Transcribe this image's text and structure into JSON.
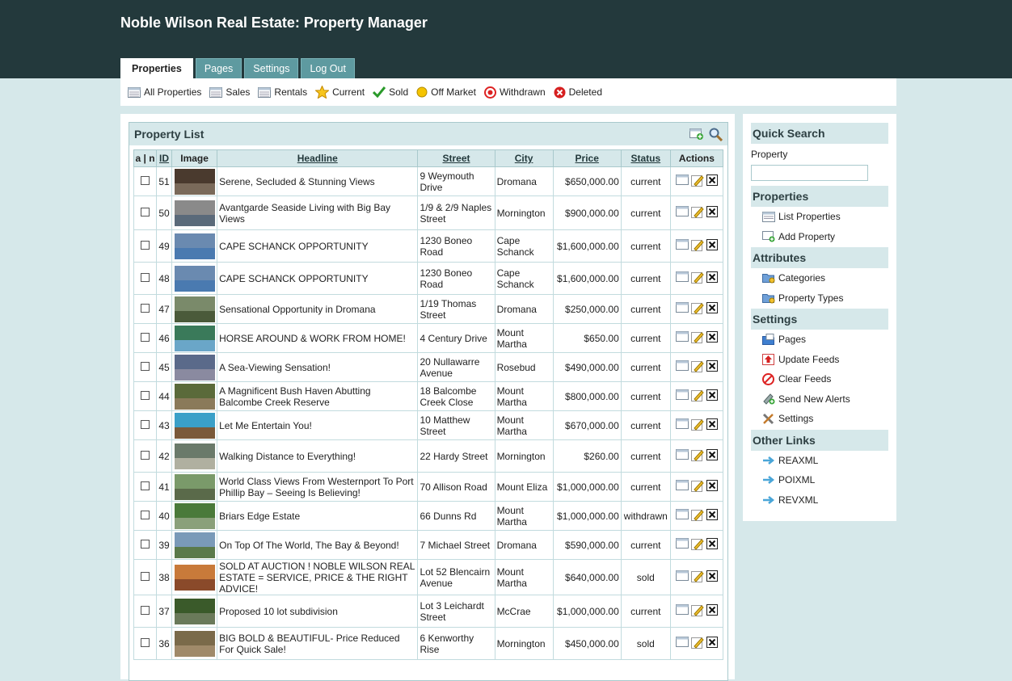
{
  "app": {
    "title": "Noble Wilson Real Estate: Property Manager"
  },
  "tabs": [
    {
      "label": "Properties",
      "active": true
    },
    {
      "label": "Pages"
    },
    {
      "label": "Settings"
    },
    {
      "label": "Log Out"
    }
  ],
  "filters": [
    {
      "label": "All Properties",
      "icon": "list-icon"
    },
    {
      "label": "Sales",
      "icon": "list-icon"
    },
    {
      "label": "Rentals",
      "icon": "list-icon"
    },
    {
      "label": "Current",
      "icon": "star-icon"
    },
    {
      "label": "Sold",
      "icon": "check-icon"
    },
    {
      "label": "Off Market",
      "icon": "yellow-dot-icon"
    },
    {
      "label": "Withdrawn",
      "icon": "withdrawn-icon"
    },
    {
      "label": "Deleted",
      "icon": "deleted-icon"
    }
  ],
  "property_list": {
    "title": "Property List",
    "columns": {
      "select": "a | n",
      "id": "ID",
      "image": "Image",
      "headline": "Headline",
      "street": "Street",
      "city": "City",
      "price": "Price",
      "status": "Status",
      "actions": "Actions"
    },
    "rows": [
      {
        "id": "51",
        "headline": "Serene, Secluded & Stunning Views",
        "street": "9 Weymouth Drive",
        "city": "Dromana",
        "price": "$650,000.00",
        "status": "current"
      },
      {
        "id": "50",
        "headline": "Avantgarde Seaside Living with Big Bay Views",
        "street": "1/9 & 2/9 Naples Street",
        "city": "Mornington",
        "price": "$900,000.00",
        "status": "current"
      },
      {
        "id": "49",
        "headline": "CAPE SCHANCK OPPORTUNITY",
        "street": "1230 Boneo Road",
        "city": "Cape Schanck",
        "price": "$1,600,000.00",
        "status": "current"
      },
      {
        "id": "48",
        "headline": "CAPE SCHANCK OPPORTUNITY",
        "street": "1230 Boneo Road",
        "city": "Cape Schanck",
        "price": "$1,600,000.00",
        "status": "current"
      },
      {
        "id": "47",
        "headline": "Sensational Opportunity in Dromana",
        "street": "1/19 Thomas Street",
        "city": "Dromana",
        "price": "$250,000.00",
        "status": "current"
      },
      {
        "id": "46",
        "headline": "HORSE AROUND & WORK FROM HOME!",
        "street": "4 Century Drive",
        "city": "Mount Martha",
        "price": "$650.00",
        "status": "current"
      },
      {
        "id": "45",
        "headline": "A Sea-Viewing Sensation!",
        "street": "20 Nullawarre Avenue",
        "city": "Rosebud",
        "price": "$490,000.00",
        "status": "current"
      },
      {
        "id": "44",
        "headline": "A Magnificent Bush Haven Abutting Balcombe Creek Reserve",
        "street": "18 Balcombe Creek Close",
        "city": "Mount Martha",
        "price": "$800,000.00",
        "status": "current"
      },
      {
        "id": "43",
        "headline": "Let Me Entertain You!",
        "street": "10 Matthew Street",
        "city": "Mount Martha",
        "price": "$670,000.00",
        "status": "current"
      },
      {
        "id": "42",
        "headline": "Walking Distance to Everything!",
        "street": "22 Hardy Street",
        "city": "Mornington",
        "price": "$260.00",
        "status": "current"
      },
      {
        "id": "41",
        "headline": "World Class Views From Westernport To Port Phillip Bay – Seeing Is Believing!",
        "street": "70 Allison Road",
        "city": "Mount Eliza",
        "price": "$1,000,000.00",
        "status": "current"
      },
      {
        "id": "40",
        "headline": "Briars Edge Estate",
        "street": "66 Dunns Rd",
        "city": "Mount Martha",
        "price": "$1,000,000.00",
        "status": "withdrawn"
      },
      {
        "id": "39",
        "headline": "On Top Of The World, The Bay & Beyond!",
        "street": "7 Michael Street",
        "city": "Dromana",
        "price": "$590,000.00",
        "status": "current"
      },
      {
        "id": "38",
        "headline": "SOLD AT AUCTION ! NOBLE WILSON REAL ESTATE = SERVICE, PRICE & THE RIGHT ADVICE!",
        "street": "Lot 52 Blencairn Avenue",
        "city": "Mount Martha",
        "price": "$640,000.00",
        "status": "sold"
      },
      {
        "id": "37",
        "headline": "Proposed 10 lot subdivision",
        "street": "Lot 3 Leichardt Street",
        "city": "McCrae",
        "price": "$1,000,000.00",
        "status": "current"
      },
      {
        "id": "36",
        "headline": "BIG BOLD & BEAUTIFUL- Price Reduced For Quick Sale!",
        "street": "6 Kenworthy Rise",
        "city": "Mornington",
        "price": "$450,000.00",
        "status": "sold"
      }
    ]
  },
  "sidebar": {
    "quick_search": {
      "title": "Quick Search",
      "label": "Property",
      "value": ""
    },
    "sections": [
      {
        "title": "Properties",
        "items": [
          {
            "label": "List Properties",
            "icon": "list-icon"
          },
          {
            "label": "Add Property",
            "icon": "add-icon"
          }
        ]
      },
      {
        "title": "Attributes",
        "items": [
          {
            "label": "Categories",
            "icon": "folder-icon"
          },
          {
            "label": "Property Types",
            "icon": "folder-icon"
          }
        ]
      },
      {
        "title": "Settings",
        "items": [
          {
            "label": "Pages",
            "icon": "pages-icon"
          },
          {
            "label": "Update Feeds",
            "icon": "update-icon"
          },
          {
            "label": "Clear Feeds",
            "icon": "clear-icon"
          },
          {
            "label": "Send New Alerts",
            "icon": "alert-icon"
          },
          {
            "label": "Settings",
            "icon": "tools-icon"
          }
        ]
      },
      {
        "title": "Other Links",
        "items": [
          {
            "label": "REAXML",
            "icon": "arrow-icon"
          },
          {
            "label": "POIXML",
            "icon": "arrow-icon"
          },
          {
            "label": "REVXML",
            "icon": "arrow-icon"
          }
        ]
      }
    ]
  }
}
